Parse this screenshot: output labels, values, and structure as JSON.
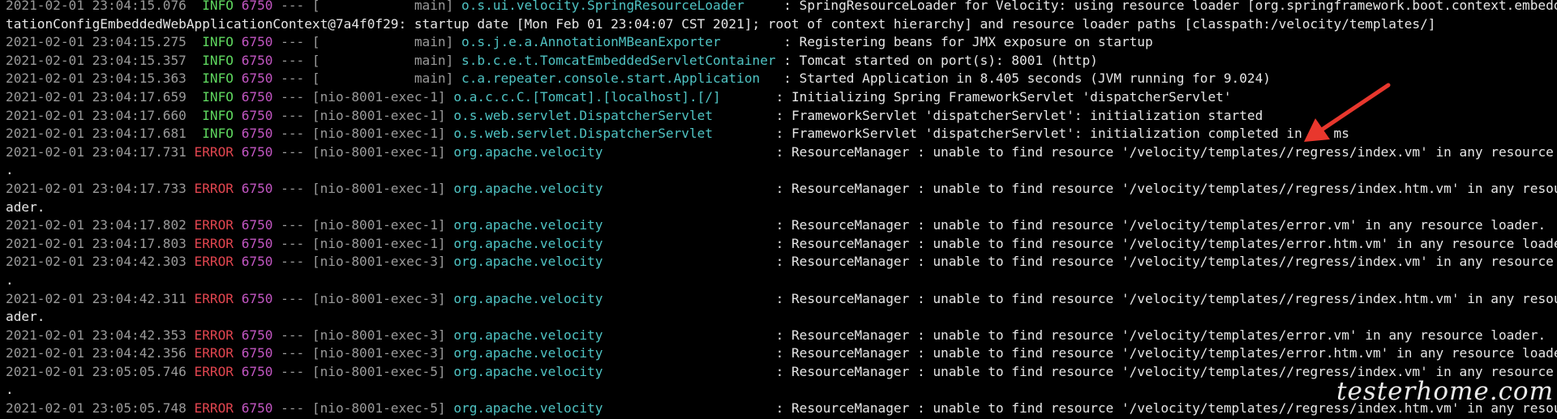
{
  "terminal": {
    "colors": {
      "background": "#000000",
      "default": "#e6e6e6",
      "timestamp": "#9a9a9a",
      "info": "#5fd75f",
      "error": "#e0454f",
      "pid": "#c256c2",
      "thread": "#9a9a9a",
      "logger": "#4fc3c3",
      "message": "#e6e6e6",
      "annotation_arrow": "#e8372d"
    },
    "lines": [
      {
        "segments": [
          {
            "text": "2021-02-01 23:04:15.076 ",
            "role": "timestamp"
          },
          {
            "text": " INFO",
            "role": "info"
          },
          {
            "text": " 6750",
            "role": "pid"
          },
          {
            "text": " --- [            main] ",
            "role": "thread"
          },
          {
            "text": "o.s.ui.velocity.SpringResourceLoader    ",
            "role": "logger"
          },
          {
            "text": " : SpringResourceLoader for Velocity: using resource loader [org.springframework.boot.context.embedded.Anno",
            "role": "message"
          }
        ]
      },
      {
        "segments": [
          {
            "text": "tationConfigEmbeddedWebApplicationContext@7a4f0f29: startup date [Mon Feb 01 23:04:07 CST 2021]; root of context hierarchy] and resource loader paths [classpath:/velocity/templates/]",
            "role": "message"
          }
        ]
      },
      {
        "segments": [
          {
            "text": "2021-02-01 23:04:15.275 ",
            "role": "timestamp"
          },
          {
            "text": " INFO",
            "role": "info"
          },
          {
            "text": " 6750",
            "role": "pid"
          },
          {
            "text": " --- [            main] ",
            "role": "thread"
          },
          {
            "text": "o.s.j.e.a.AnnotationMBeanExporter       ",
            "role": "logger"
          },
          {
            "text": " : Registering beans for JMX exposure on startup",
            "role": "message"
          }
        ]
      },
      {
        "segments": [
          {
            "text": "2021-02-01 23:04:15.357 ",
            "role": "timestamp"
          },
          {
            "text": " INFO",
            "role": "info"
          },
          {
            "text": " 6750",
            "role": "pid"
          },
          {
            "text": " --- [            main] ",
            "role": "thread"
          },
          {
            "text": "s.b.c.e.t.TomcatEmbeddedServletContainer",
            "role": "logger"
          },
          {
            "text": " : Tomcat started on port(s): 8001 (http)",
            "role": "message"
          }
        ]
      },
      {
        "segments": [
          {
            "text": "2021-02-01 23:04:15.363 ",
            "role": "timestamp"
          },
          {
            "text": " INFO",
            "role": "info"
          },
          {
            "text": " 6750",
            "role": "pid"
          },
          {
            "text": " --- [            main] ",
            "role": "thread"
          },
          {
            "text": "c.a.repeater.console.start.Application  ",
            "role": "logger"
          },
          {
            "text": " : Started Application in 8.405 seconds (JVM running for 9.024)",
            "role": "message"
          }
        ]
      },
      {
        "segments": [
          {
            "text": "2021-02-01 23:04:17.659 ",
            "role": "timestamp"
          },
          {
            "text": " INFO",
            "role": "info"
          },
          {
            "text": " 6750",
            "role": "pid"
          },
          {
            "text": " --- [nio-8001-exec-1] ",
            "role": "thread"
          },
          {
            "text": "o.a.c.c.C.[Tomcat].[localhost].[/]      ",
            "role": "logger"
          },
          {
            "text": " : Initializing Spring FrameworkServlet 'dispatcherServlet'",
            "role": "message"
          }
        ]
      },
      {
        "segments": [
          {
            "text": "2021-02-01 23:04:17.660 ",
            "role": "timestamp"
          },
          {
            "text": " INFO",
            "role": "info"
          },
          {
            "text": " 6750",
            "role": "pid"
          },
          {
            "text": " --- [nio-8001-exec-1] ",
            "role": "thread"
          },
          {
            "text": "o.s.web.servlet.DispatcherServlet       ",
            "role": "logger"
          },
          {
            "text": " : FrameworkServlet 'dispatcherServlet': initialization started",
            "role": "message"
          }
        ]
      },
      {
        "segments": [
          {
            "text": "2021-02-01 23:04:17.681 ",
            "role": "timestamp"
          },
          {
            "text": " INFO",
            "role": "info"
          },
          {
            "text": " 6750",
            "role": "pid"
          },
          {
            "text": " --- [nio-8001-exec-1] ",
            "role": "thread"
          },
          {
            "text": "o.s.web.servlet.DispatcherServlet       ",
            "role": "logger"
          },
          {
            "text": " : FrameworkServlet 'dispatcherServlet': initialization completed in 21 ms",
            "role": "message"
          }
        ]
      },
      {
        "segments": [
          {
            "text": "2021-02-01 23:04:17.731 ",
            "role": "timestamp"
          },
          {
            "text": "ERROR",
            "role": "error"
          },
          {
            "text": " 6750",
            "role": "pid"
          },
          {
            "text": " --- [nio-8001-exec-1] ",
            "role": "thread"
          },
          {
            "text": "org.apache.velocity                     ",
            "role": "logger"
          },
          {
            "text": " : ResourceManager : unable to find resource '/velocity/templates//regress/index.vm' in any resource loader",
            "role": "message"
          }
        ]
      },
      {
        "segments": [
          {
            "text": ".",
            "role": "message"
          }
        ]
      },
      {
        "segments": [
          {
            "text": "2021-02-01 23:04:17.733 ",
            "role": "timestamp"
          },
          {
            "text": "ERROR",
            "role": "error"
          },
          {
            "text": " 6750",
            "role": "pid"
          },
          {
            "text": " --- [nio-8001-exec-1] ",
            "role": "thread"
          },
          {
            "text": "org.apache.velocity                     ",
            "role": "logger"
          },
          {
            "text": " : ResourceManager : unable to find resource '/velocity/templates//regress/index.htm.vm' in any resource lo",
            "role": "message"
          }
        ]
      },
      {
        "segments": [
          {
            "text": "ader.",
            "role": "message"
          }
        ]
      },
      {
        "segments": [
          {
            "text": "2021-02-01 23:04:17.802 ",
            "role": "timestamp"
          },
          {
            "text": "ERROR",
            "role": "error"
          },
          {
            "text": " 6750",
            "role": "pid"
          },
          {
            "text": " --- [nio-8001-exec-1] ",
            "role": "thread"
          },
          {
            "text": "org.apache.velocity                     ",
            "role": "logger"
          },
          {
            "text": " : ResourceManager : unable to find resource '/velocity/templates/error.vm' in any resource loader.",
            "role": "message"
          }
        ]
      },
      {
        "segments": [
          {
            "text": "2021-02-01 23:04:17.803 ",
            "role": "timestamp"
          },
          {
            "text": "ERROR",
            "role": "error"
          },
          {
            "text": " 6750",
            "role": "pid"
          },
          {
            "text": " --- [nio-8001-exec-1] ",
            "role": "thread"
          },
          {
            "text": "org.apache.velocity                     ",
            "role": "logger"
          },
          {
            "text": " : ResourceManager : unable to find resource '/velocity/templates/error.htm.vm' in any resource loader.",
            "role": "message"
          }
        ]
      },
      {
        "segments": [
          {
            "text": "2021-02-01 23:04:42.303 ",
            "role": "timestamp"
          },
          {
            "text": "ERROR",
            "role": "error"
          },
          {
            "text": " 6750",
            "role": "pid"
          },
          {
            "text": " --- [nio-8001-exec-3] ",
            "role": "thread"
          },
          {
            "text": "org.apache.velocity                     ",
            "role": "logger"
          },
          {
            "text": " : ResourceManager : unable to find resource '/velocity/templates//regress/index.vm' in any resource loader",
            "role": "message"
          }
        ]
      },
      {
        "segments": [
          {
            "text": ".",
            "role": "message"
          }
        ]
      },
      {
        "segments": [
          {
            "text": "2021-02-01 23:04:42.311 ",
            "role": "timestamp"
          },
          {
            "text": "ERROR",
            "role": "error"
          },
          {
            "text": " 6750",
            "role": "pid"
          },
          {
            "text": " --- [nio-8001-exec-3] ",
            "role": "thread"
          },
          {
            "text": "org.apache.velocity                     ",
            "role": "logger"
          },
          {
            "text": " : ResourceManager : unable to find resource '/velocity/templates//regress/index.htm.vm' in any resource lo",
            "role": "message"
          }
        ]
      },
      {
        "segments": [
          {
            "text": "ader.",
            "role": "message"
          }
        ]
      },
      {
        "segments": [
          {
            "text": "2021-02-01 23:04:42.353 ",
            "role": "timestamp"
          },
          {
            "text": "ERROR",
            "role": "error"
          },
          {
            "text": " 6750",
            "role": "pid"
          },
          {
            "text": " --- [nio-8001-exec-3] ",
            "role": "thread"
          },
          {
            "text": "org.apache.velocity                     ",
            "role": "logger"
          },
          {
            "text": " : ResourceManager : unable to find resource '/velocity/templates/error.vm' in any resource loader.",
            "role": "message"
          }
        ]
      },
      {
        "segments": [
          {
            "text": "2021-02-01 23:04:42.356 ",
            "role": "timestamp"
          },
          {
            "text": "ERROR",
            "role": "error"
          },
          {
            "text": " 6750",
            "role": "pid"
          },
          {
            "text": " --- [nio-8001-exec-3] ",
            "role": "thread"
          },
          {
            "text": "org.apache.velocity                     ",
            "role": "logger"
          },
          {
            "text": " : ResourceManager : unable to find resource '/velocity/templates/error.htm.vm' in any resource loader.",
            "role": "message"
          }
        ]
      },
      {
        "segments": [
          {
            "text": "2021-02-01 23:05:05.746 ",
            "role": "timestamp"
          },
          {
            "text": "ERROR",
            "role": "error"
          },
          {
            "text": " 6750",
            "role": "pid"
          },
          {
            "text": " --- [nio-8001-exec-5] ",
            "role": "thread"
          },
          {
            "text": "org.apache.velocity                     ",
            "role": "logger"
          },
          {
            "text": " : ResourceManager : unable to find resource '/velocity/templates//regress/index.vm' in any resource loader",
            "role": "message"
          }
        ]
      },
      {
        "segments": [
          {
            "text": ".",
            "role": "message"
          }
        ]
      },
      {
        "segments": [
          {
            "text": "2021-02-01 23:05:05.748 ",
            "role": "timestamp"
          },
          {
            "text": "ERROR",
            "role": "error"
          },
          {
            "text": " 6750",
            "role": "pid"
          },
          {
            "text": " --- [nio-8001-exec-5] ",
            "role": "thread"
          },
          {
            "text": "org.apache.velocity                     ",
            "role": "logger"
          },
          {
            "text": " : ResourceManager : unable to find resource '/velocity/templates//regress/index.htm.vm' in any resource lo",
            "role": "message"
          }
        ]
      }
    ]
  },
  "watermark": {
    "text": "testerhome.com"
  },
  "annotation": {
    "icon": "red-arrow-icon"
  }
}
